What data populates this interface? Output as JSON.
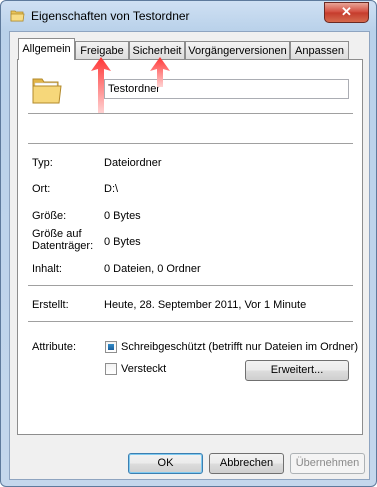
{
  "window": {
    "title": "Eigenschaften von Testordner",
    "close_label": "✕"
  },
  "tabs": [
    {
      "label": "Allgemein"
    },
    {
      "label": "Freigabe"
    },
    {
      "label": "Sicherheit"
    },
    {
      "label": "Vorgängerversionen"
    },
    {
      "label": "Anpassen"
    }
  ],
  "folder_name": "Testordner",
  "info": {
    "type_label": "Typ:",
    "type_value": "Dateiordner",
    "location_label": "Ort:",
    "location_value": "D:\\",
    "size_label": "Größe:",
    "size_value": "0 Bytes",
    "disk_size_label_1": "Größe auf",
    "disk_size_label_2": "Datenträger:",
    "disk_size_value": "0 Bytes",
    "contents_label": "Inhalt:",
    "contents_value": "0 Dateien, 0 Ordner",
    "created_label": "Erstellt:",
    "created_value": "Heute, 28. September 2011, Vor 1 Minute"
  },
  "attributes": {
    "label": "Attribute:",
    "readonly_label": "Schreibgeschützt (betrifft nur Dateien im Ordner)",
    "readonly_state": "indeterminate",
    "hidden_label": "Versteckt",
    "hidden_state": "unchecked",
    "advanced_button": "Erweitert..."
  },
  "buttons": {
    "ok": "OK",
    "cancel": "Abbrechen",
    "apply": "Übernehmen"
  },
  "colors": {
    "annotation_arrow": "#e0101e",
    "checkbox_fill": "#1f6aa8"
  }
}
